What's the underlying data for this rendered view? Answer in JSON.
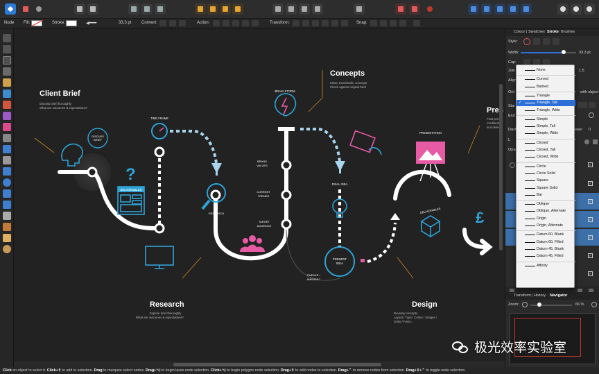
{
  "context_bar": {
    "mode": "Node",
    "fill_label": "Fill:",
    "stroke_label": "Stroke:",
    "stroke_width": "33.3 pt",
    "convert_label": "Convert:",
    "action_label": "Action:",
    "transform_label": "Transform:",
    "snap_label": "Snap:"
  },
  "infographic": {
    "client_brief": {
      "title": "Client Brief",
      "line1": "Discuss brief thoroughly",
      "line2": "What are outcomes & expectations?"
    },
    "discuss_brief": [
      "DISCUSS",
      "BRIEF"
    ],
    "deliverables_tag": "DELIVERABLES",
    "time_frame": "TIME FRAME",
    "research": {
      "title": "Research",
      "line1": "Explore brief thoroughly",
      "line2": "What are outcomes & expectations?",
      "icon_label": "RESEARCH"
    },
    "concepts": {
      "title": "Concepts",
      "line1": "Ideas, thumbnails, concepts",
      "line2": "Check against original brief"
    },
    "brain_storm": "BRAIN STORM",
    "brand_values": [
      "BRAND",
      "VALUES"
    ],
    "current_trends": [
      "CURRENT",
      "TRENDS"
    ],
    "target_audience": [
      "TARGET",
      "AUDIENCE"
    ],
    "final_idea": "FINAL IDEA",
    "present_idea": [
      "PRESENT",
      "IDEA"
    ],
    "tweaks": [
      "TWEAKS /",
      "AMENDS?"
    ],
    "design": {
      "title": "Design",
      "line1": "Develop concepts",
      "line2": "Layout / Type / Colour / Images /",
      "line3": "Grids / Fonts..."
    },
    "presentation": "PRESENTATION",
    "deliverables_icon": "DELIVERABLES",
    "present_cut": {
      "title": "Pres",
      "line1": "Final prese",
      "line2": "Confidenti",
      "line3": "and delive"
    },
    "pound": "£",
    "question": "?"
  },
  "panel": {
    "tabs": [
      "Colour",
      "Swatches",
      "Stroke",
      "Brushes"
    ],
    "active_tab": "Stroke",
    "style_label": "Style:",
    "width_label": "Width:",
    "width_value": "33.3 pt",
    "width_fraction": 0.78,
    "cap_label": "Cap:",
    "join_label": "Join",
    "align_label": "Align",
    "order_label": "Ord",
    "with_object": "with object",
    "start_label": "Star",
    "end_label": "End",
    "dash_label": "Dash",
    "phase_label": "hase:",
    "phase_value": "0",
    "join_value": "1.5",
    "layers_label": "L",
    "opacity_label": "Opac",
    "transform_tabs": [
      "Transform",
      "History",
      "Navigator"
    ],
    "active_transform_tab": "Navigator",
    "zoom_label": "Zoom:",
    "zoom_value": "66 %"
  },
  "arrowhead_menu": {
    "items": [
      {
        "label": "None"
      },
      {
        "label": "Curved"
      },
      {
        "label": "Barbed"
      },
      {
        "label": "Triangle"
      },
      {
        "label": "Triangle, Tall",
        "selected": true
      },
      {
        "label": "Triangle, Wide"
      },
      {
        "label": "Simple"
      },
      {
        "label": "Simple, Tall"
      },
      {
        "label": "Simple, Wide"
      },
      {
        "label": "Closed"
      },
      {
        "label": "Closed, Tall"
      },
      {
        "label": "Closed, Wide"
      },
      {
        "label": "Circle"
      },
      {
        "label": "Circle Solid"
      },
      {
        "label": "Square"
      },
      {
        "label": "Square Solid"
      },
      {
        "label": "Bar"
      },
      {
        "label": "Oblique"
      },
      {
        "label": "Oblique, Alternate"
      },
      {
        "label": "Origin"
      },
      {
        "label": "Origin, Alternate"
      },
      {
        "label": "Datum 60, Blank"
      },
      {
        "label": "Datum 60, Filled"
      },
      {
        "label": "Datum 45, Blank"
      },
      {
        "label": "Datum 45, Filled"
      },
      {
        "label": "Affinity"
      }
    ]
  },
  "status_bar": {
    "s1": "Click",
    "t1": " an object to select it. ",
    "s2": "Click+⇧",
    "t2": " to add to selection. ",
    "s3": "Drag",
    "t3": " to marquee select nodes. ",
    "s4": "Drag+⌥",
    "t4": " to begin lasso node selection. ",
    "s5": "Click+⌥",
    "t5": " to begin polygon node selection. ",
    "s6": "Drag+⇧",
    "t6": " to add nodes to selection. ",
    "s7": "Drag+⌃",
    "t7": " to remove nodes from selection. ",
    "s8": "Drag+⇧+⌃",
    "t8": " to toggle node selection."
  },
  "watermark": "极光效率实验室",
  "colors": {
    "accent_blue": "#2ea3d6",
    "accent_pink": "#e75aa4",
    "accent_orange": "#d9901a",
    "menu_selected": "#2d6fd6"
  }
}
